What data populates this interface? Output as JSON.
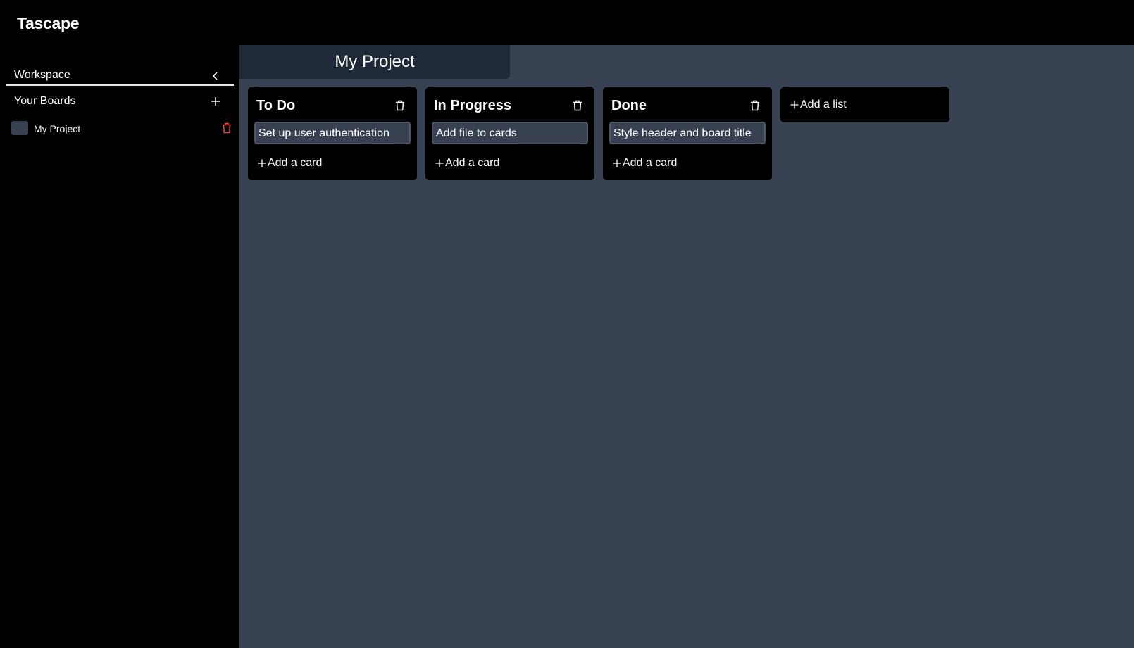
{
  "app": {
    "name": "Tascape"
  },
  "sidebar": {
    "workspace_label": "Workspace",
    "boards_label": "Your Boards",
    "boards": [
      {
        "name": "My Project",
        "color": "#374151"
      }
    ]
  },
  "board": {
    "title": "My Project",
    "lists": [
      {
        "title": "To Do",
        "cards": [
          "Set up user authentication"
        ],
        "add_card_label": "Add a card"
      },
      {
        "title": "In Progress",
        "cards": [
          "Add file to cards"
        ],
        "add_card_label": "Add a card"
      },
      {
        "title": "Done",
        "cards": [
          "Style header and board title"
        ],
        "add_card_label": "Add a card"
      }
    ],
    "add_list_label": "Add a list"
  },
  "colors": {
    "background": "#000000",
    "board_bg": "#374151",
    "title_bar_bg": "#1f2937",
    "card_bg": "#374151",
    "danger": "#ef4444"
  },
  "icons": {
    "collapse": "chevron-left-icon",
    "add": "plus-icon",
    "delete": "trash-icon"
  }
}
